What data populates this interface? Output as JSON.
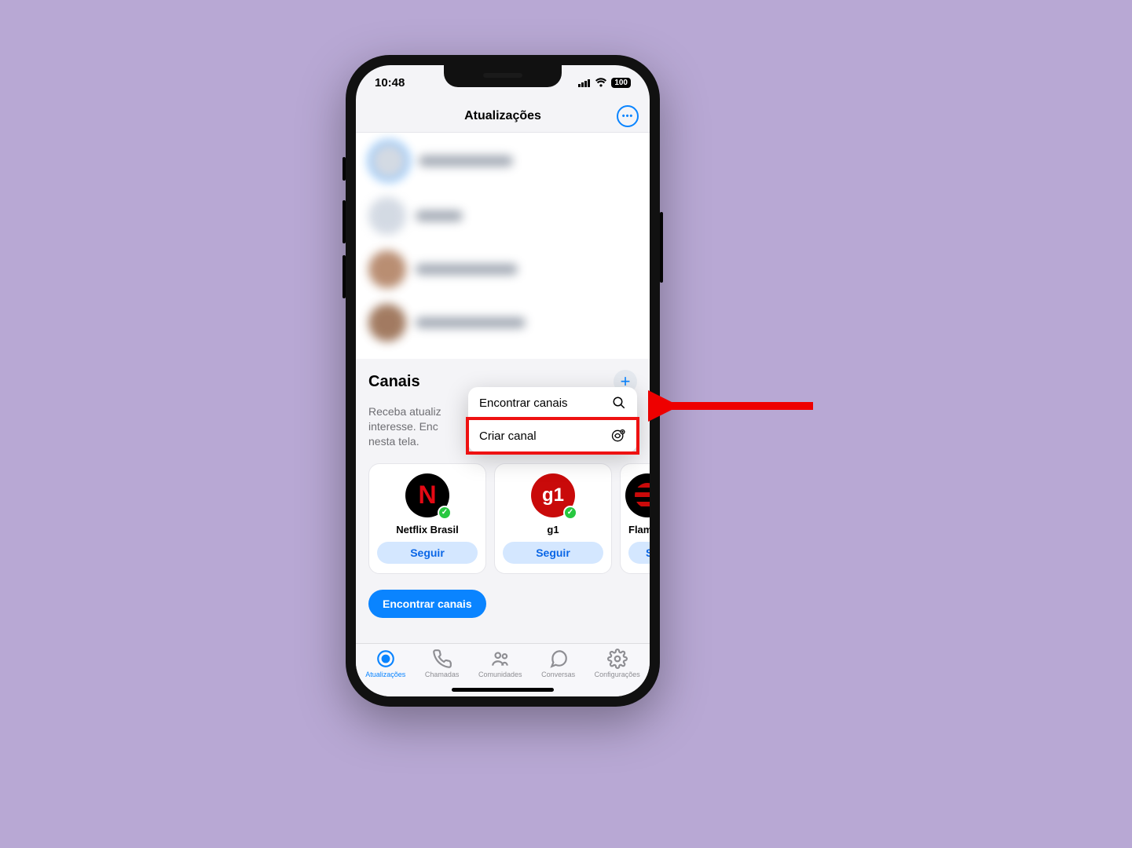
{
  "status_bar": {
    "time": "10:48",
    "battery": "100"
  },
  "header": {
    "title": "Atualizações",
    "more_icon": "more-horizontal"
  },
  "channels": {
    "section_title": "Canais",
    "description_line1": "Receba atualiz",
    "description_line2": "interesse. Enc",
    "description_line3": "nesta tela.",
    "plus_icon": "plus",
    "popup": {
      "find": "Encontrar canais",
      "create": "Criar canal"
    },
    "cards": [
      {
        "id": "netflix",
        "name": "Netflix Brasil",
        "follow": "Seguir"
      },
      {
        "id": "g1",
        "name": "g1",
        "follow": "Seguir"
      },
      {
        "id": "flamengo",
        "name": "Flamengo",
        "follow": "Seg"
      }
    ],
    "find_button": "Encontrar canais"
  },
  "tabs": {
    "updates": "Atualizações",
    "calls": "Chamadas",
    "communities": "Comunidades",
    "chats": "Conversas",
    "settings": "Configurações"
  }
}
